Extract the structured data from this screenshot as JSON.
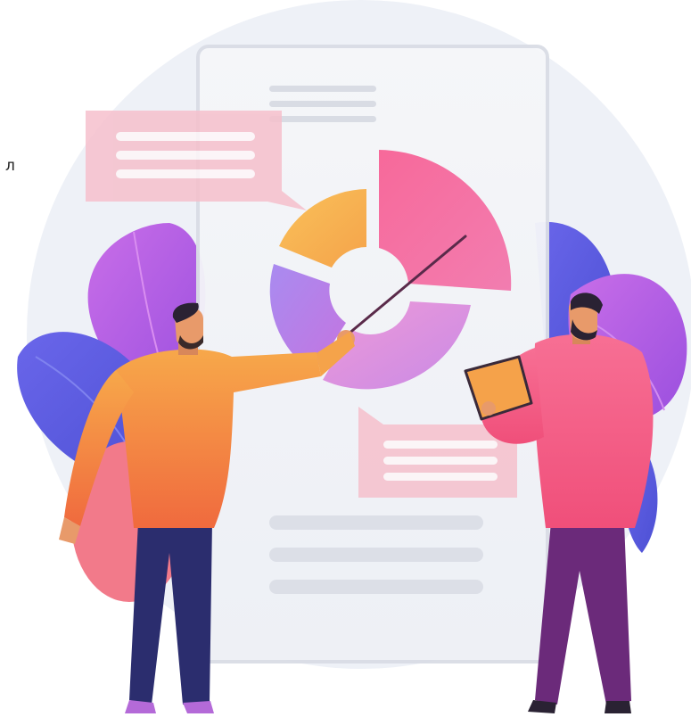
{
  "stray_text": "л",
  "illustration": {
    "colors": {
      "background_circle": "#edf0f6",
      "board": "#f4f5f8",
      "board_border": "#dde0e8",
      "text_line": "#d6d9e2",
      "bubble": "#f7c6d0",
      "bubble_line": "#ffffff",
      "leaf_blue": "#5b5fe0",
      "leaf_purple": "#b35fe6",
      "leaf_coral": "#f27a8a",
      "slice_yellow": "#f7b24b",
      "slice_pink": "#f56ba0",
      "slice_purple": "#b77fe8",
      "slice_orchid": "#e48ad8",
      "shirt_orange": "#f59a44",
      "shirt_pink": "#f76f94",
      "pants_navy": "#2b2d6e",
      "pants_plum": "#6b2a7a",
      "skin": "#e89a6a",
      "hair": "#2a2233",
      "tablet": "#f5a24a"
    },
    "pie_slices": [
      "slice_yellow",
      "slice_pink",
      "slice_orchid",
      "slice_purple"
    ]
  }
}
